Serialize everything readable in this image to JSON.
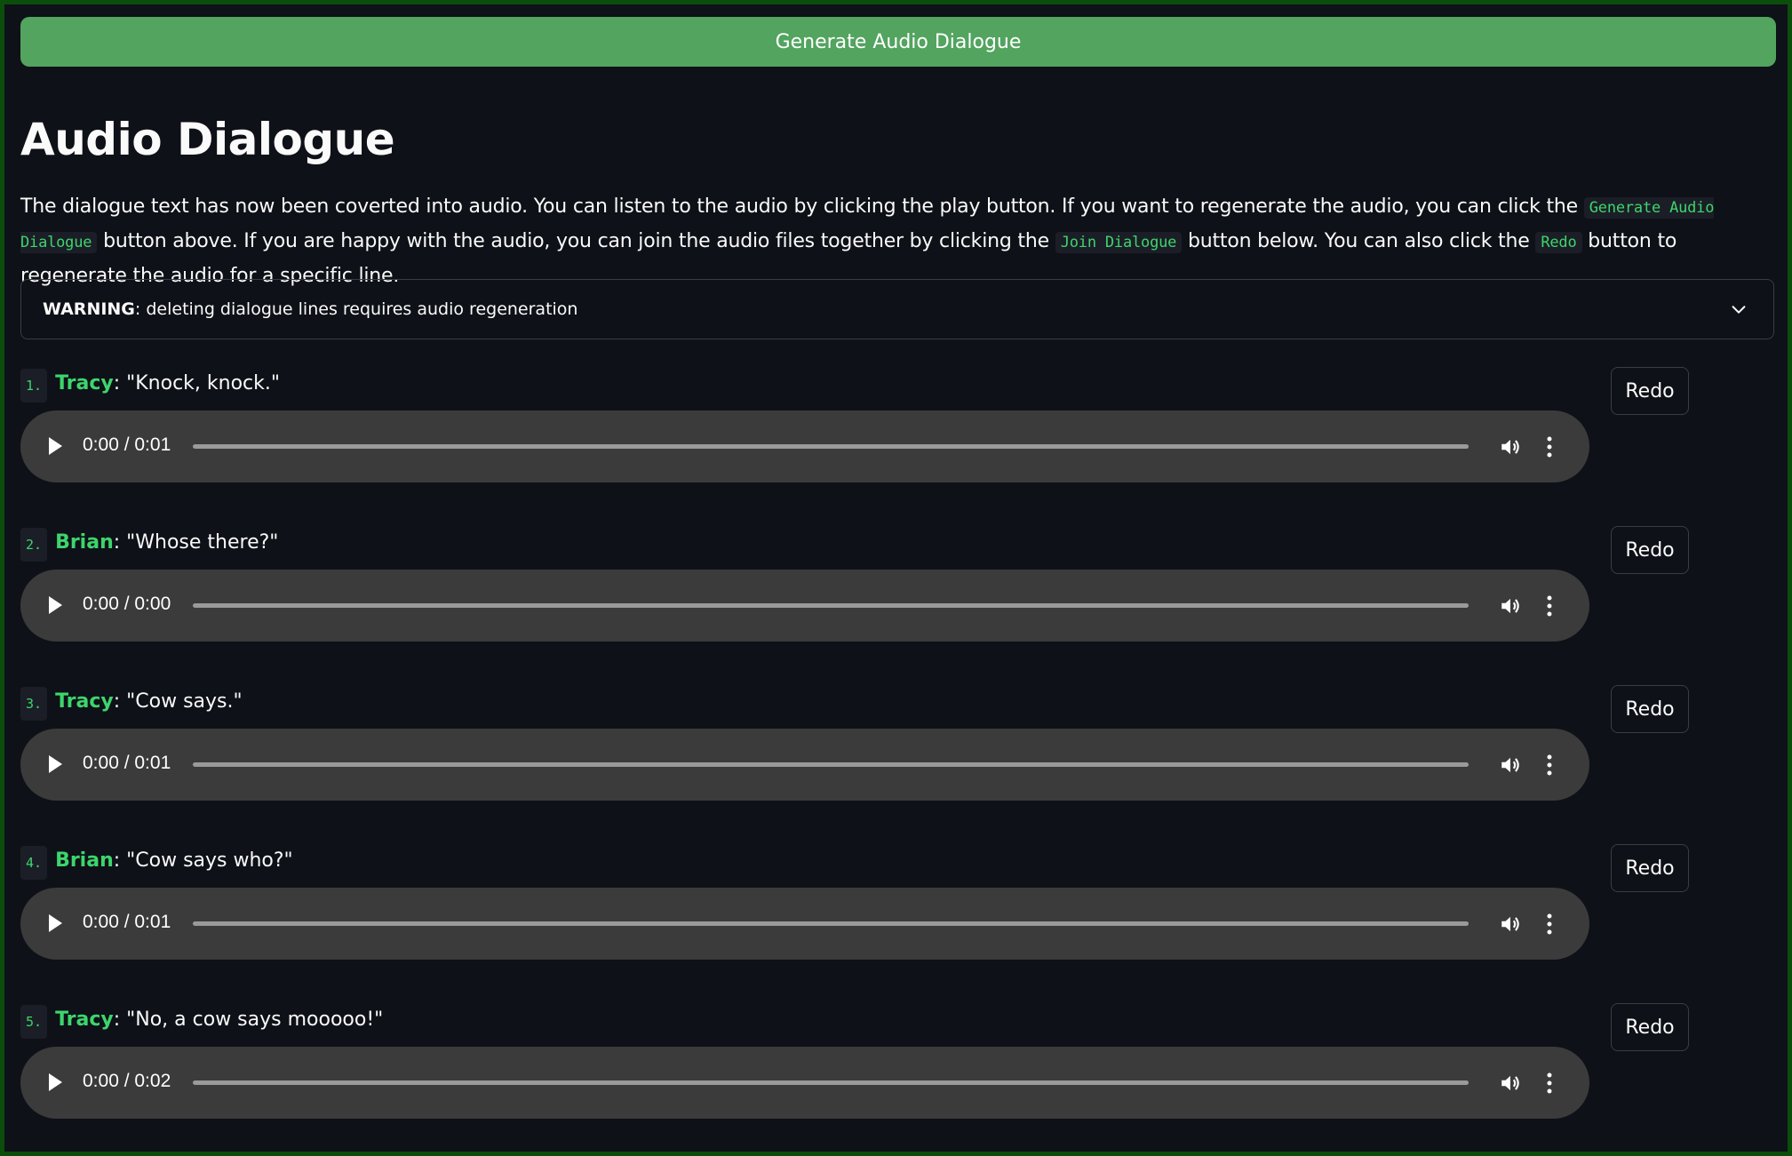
{
  "generate_button": {
    "label": "Generate Audio Dialogue"
  },
  "title": "Audio Dialogue",
  "intro": {
    "t1": "The dialogue text has now been coverted into audio. You can listen to the audio by clicking the play button. If you want to regenerate the audio, you can click the ",
    "code1": "Generate Audio Dialogue",
    "t2": " button above. If you are happy with the audio, you can join the audio files together by clicking the ",
    "code2": "Join Dialogue",
    "t3": " button below. You can also click the ",
    "code3": "Redo",
    "t4": " button to regenerate the audio for a specific line."
  },
  "warning": {
    "strong": "WARNING",
    "text": ": deleting dialogue lines requires audio regeneration",
    "icon": "chevron-down-icon"
  },
  "lines": [
    {
      "num": "1.",
      "speaker": "Tracy",
      "text": ": \"Knock, knock.\"",
      "time": "0:00 / 0:01",
      "redo": "Redo"
    },
    {
      "num": "2.",
      "speaker": "Brian",
      "text": ": \"Whose there?\"",
      "time": "0:00 / 0:00",
      "redo": "Redo"
    },
    {
      "num": "3.",
      "speaker": "Tracy",
      "text": ": \"Cow says.\"",
      "time": "0:00 / 0:01",
      "redo": "Redo"
    },
    {
      "num": "4.",
      "speaker": "Brian",
      "text": ": \"Cow says who?\"",
      "time": "0:00 / 0:01",
      "redo": "Redo"
    },
    {
      "num": "5.",
      "speaker": "Tracy",
      "text": ": \"No, a cow says mooooo!\"",
      "time": "0:00 / 0:02",
      "redo": "Redo"
    }
  ],
  "colors": {
    "background": "#0e1117",
    "accent_green": "#3dd56d",
    "button_green": "#52a45f",
    "player_bg": "#3b3b3b",
    "frame_border": "#0b4d0b"
  }
}
